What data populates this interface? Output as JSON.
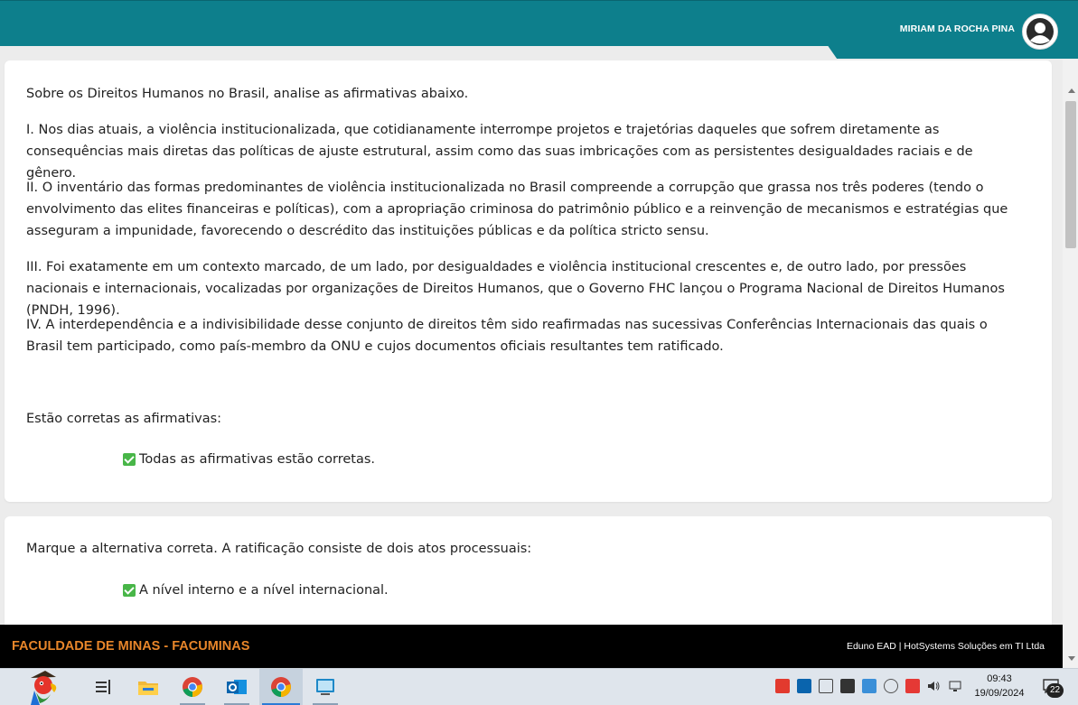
{
  "header": {
    "user_name": "MIRIAM DA ROCHA PINA"
  },
  "question1": {
    "intro": "Sobre os Direitos Humanos no Brasil, analise as afirmativas abaixo.",
    "statements": [
      "I. Nos dias atuais, a violência institucionalizada, que cotidianamente interrompe projetos e trajetórias daqueles que sofrem diretamente as consequências mais diretas das políticas de ajuste estrutural, assim como das suas imbricações com as persistentes desigualdades raciais e de gênero.",
      "II. O inventário das formas predominantes de violência institucionalizada no Brasil compreende a corrupção que grassa nos três poderes (tendo o envolvimento das elites financeiras e políticas), com a apropriação criminosa do patrimônio público e a reinvenção de mecanismos e estratégias que asseguram a impunidade, favorecendo o descrédito das instituições públicas e da política stricto sensu.",
      "III. Foi exatamente em um contexto marcado, de um lado, por desigualdades e violência institucional crescentes e, de outro lado, por pressões nacionais e internacionais, vocalizadas por organizações de Direitos Humanos, que o Governo FHC lançou o Programa Nacional de Direitos Humanos (PNDH, 1996).",
      "IV. A interdependência e a indivisibilidade desse conjunto de direitos têm sido reafirmadas nas sucessivas Conferências Internacionais das quais o Brasil tem participado, como país-membro da ONU e cujos documentos oficiais resultantes tem ratificado."
    ],
    "prompt": "Estão corretas as afirmativas:",
    "answer": "Todas as afirmativas estão corretas."
  },
  "question2": {
    "intro": "Marque a alternativa correta. A ratificação consiste de dois atos processuais:",
    "answer": "A nível interno e a nível internacional."
  },
  "footer": {
    "institution": "FACULDADE DE MINAS - FACUMINAS",
    "credits": "Eduno EAD | HotSystems Soluções em TI Ltda"
  },
  "taskbar": {
    "time": "09:43",
    "date": "19/09/2024",
    "notification_count": "22"
  },
  "colors": {
    "header": "#0d7f8c",
    "footer_text": "#e8862a",
    "check": "#48b648"
  }
}
